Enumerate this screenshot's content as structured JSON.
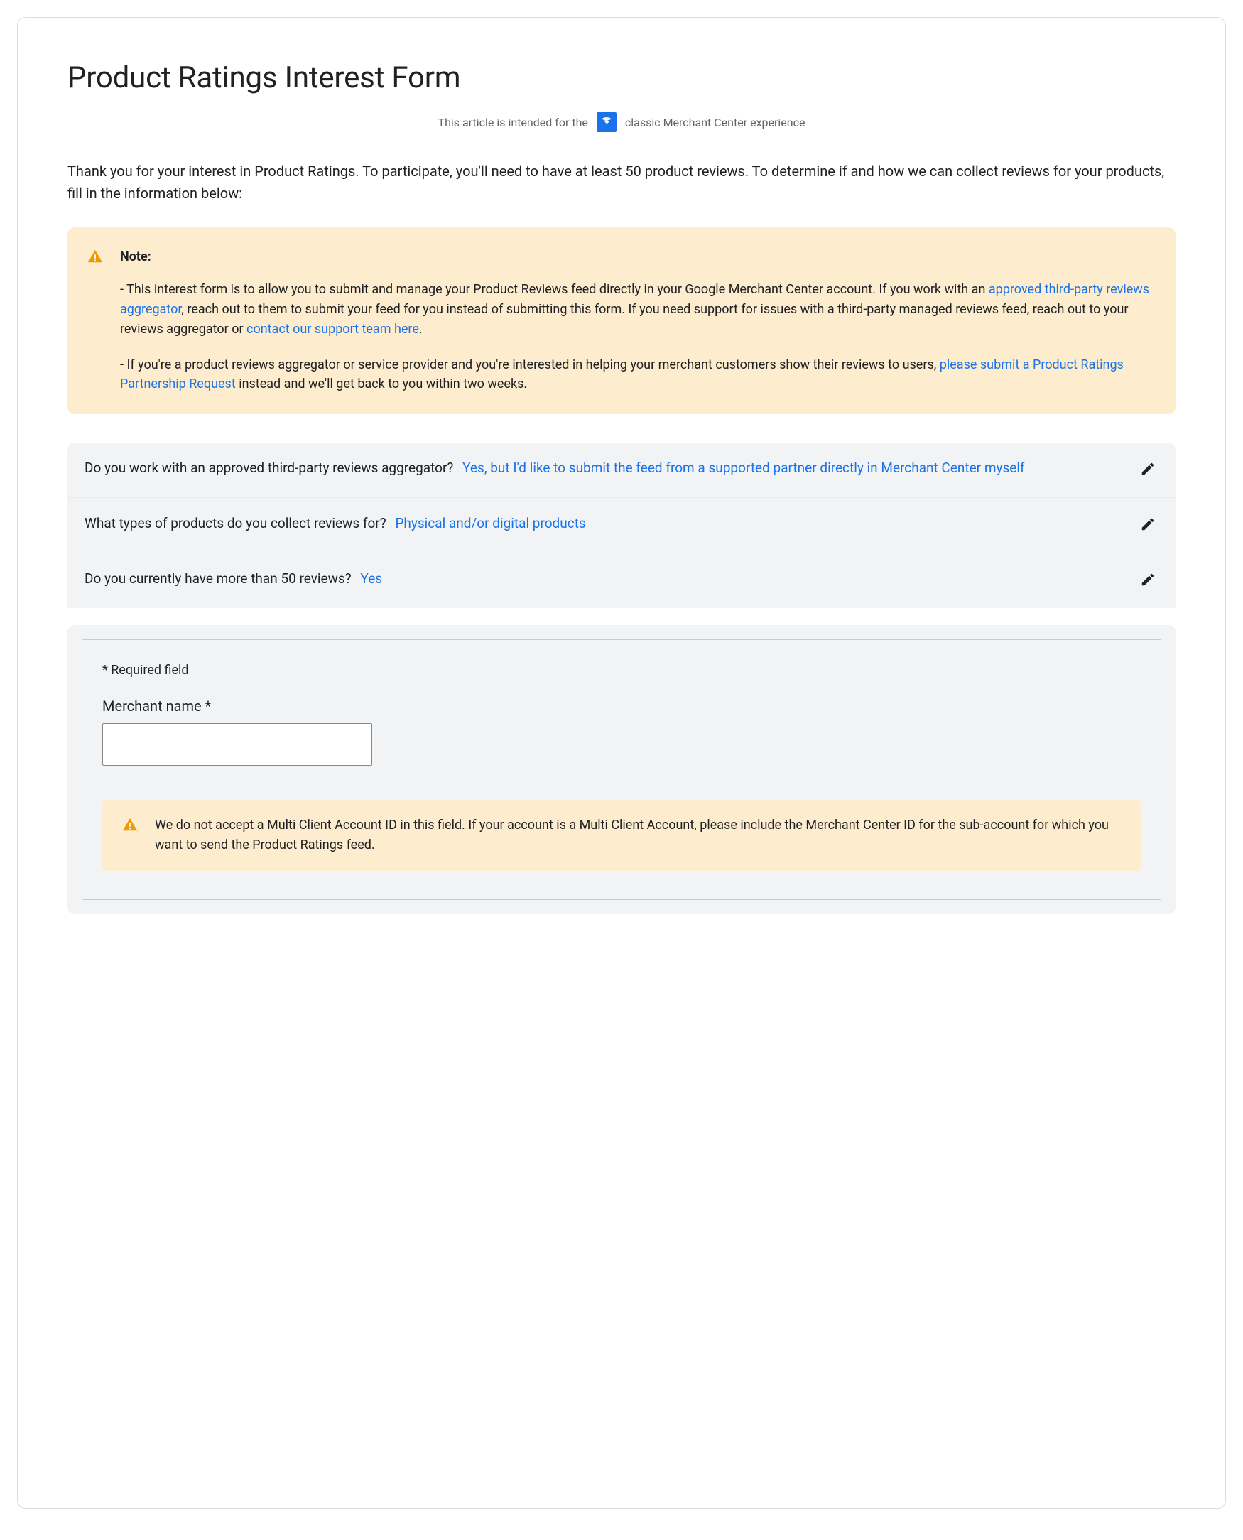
{
  "page": {
    "title": "Product Ratings Interest Form",
    "subtitle_before": "This article is intended for the",
    "subtitle_after": "classic Merchant Center experience",
    "intro": "Thank you for your interest in Product Ratings. To participate, you'll need to have at least 50 product reviews. To determine if and how we can collect reviews for your products, fill in the information below:"
  },
  "note": {
    "title": "Note:",
    "p1_a": "- This interest form is to allow you to submit and manage your Product Reviews feed directly in your Google Merchant Center account. If you work with an ",
    "p1_link1": "approved third-party reviews aggregator",
    "p1_b": ", reach out to them to submit your feed for you instead of submitting this form. If you need support for issues with a third-party managed reviews feed, reach out to your reviews aggregator or ",
    "p1_link2": "contact our support team here",
    "p1_c": ".",
    "p2_a": "- If you're a product reviews aggregator or service provider and you're interested in helping your merchant customers show their reviews to users, ",
    "p2_link": "please submit a Product Ratings Partnership Request",
    "p2_b": " instead and we'll get back to you within two weeks."
  },
  "summary": {
    "q1": "Do you work with an approved third-party reviews aggregator?",
    "a1": "Yes, but I'd like to submit the feed from a supported partner directly in Merchant Center myself",
    "q2": "What types of products do you collect reviews for?",
    "a2": "Physical and/or digital products",
    "q3": "Do you currently have more than 50 reviews?",
    "a3": "Yes"
  },
  "form": {
    "required_hint": "* Required field",
    "merchant_name_label": "Merchant name  *",
    "merchant_name_value": "",
    "mca_warning": "We do not accept a Multi Client Account ID in this field. If your account is a Multi Client Account, please include the Merchant Center ID for the sub-account for which you want to send the Product Ratings feed."
  }
}
